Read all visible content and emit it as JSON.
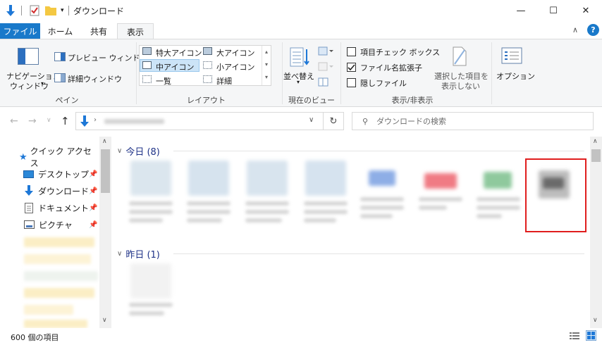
{
  "titlebar": {
    "title": "ダウンロード",
    "minimize": "—",
    "maximize": "☐",
    "close": "✕"
  },
  "tabs": {
    "file": "ファイル",
    "home": "ホーム",
    "share": "共有",
    "view": "表示"
  },
  "ribbon": {
    "navpane": {
      "label1": "ナビゲーション",
      "label2": "ウィンドウ",
      "preview": "プレビュー ウィンドウ",
      "details": "詳細ウィンドウ",
      "group": "ペイン"
    },
    "layout": {
      "xlarge": "特大アイコン",
      "large": "大アイコン",
      "medium": "中アイコン",
      "small": "小アイコン",
      "list": "一覧",
      "details": "詳細",
      "group": "レイアウト"
    },
    "currentview": {
      "sortby": "並べ替え",
      "group": "現在のビュー"
    },
    "showhide": {
      "checkboxes": "項目チェック ボックス",
      "extensions": "ファイル名拡張子",
      "hidden": "隠しファイル",
      "hide_selected_1": "選択した項目を",
      "hide_selected_2": "表示しない",
      "group": "表示/非表示"
    },
    "options": "オプション"
  },
  "address": {
    "search_placeholder": "ダウンロードの検索"
  },
  "nav": {
    "quick_access": "クイック アクセス",
    "items": [
      "デスクトップ",
      "ダウンロード",
      "ドキュメント",
      "ピクチャ"
    ]
  },
  "content": {
    "today": "今日 (8)",
    "yesterday": "昨日 (1)"
  },
  "status": {
    "count": "600 個の項目"
  },
  "colors": {
    "accent": "#1979ca",
    "highlight": "#e01e1e",
    "group_header": "#1e3287"
  }
}
